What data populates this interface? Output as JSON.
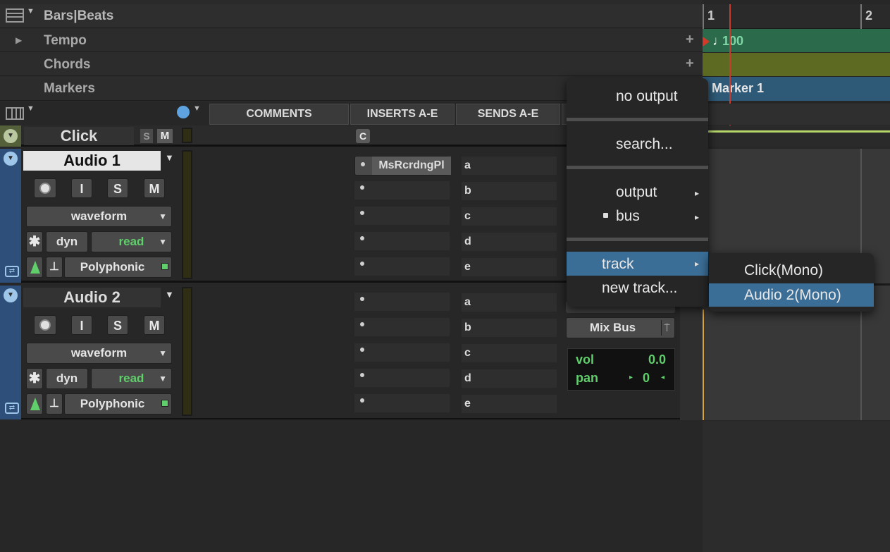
{
  "rulers": {
    "timebase": "Bars|Beats",
    "tempo": "Tempo",
    "chords": "Chords",
    "markers": "Markers",
    "bar_1": "1",
    "bar_2": "2",
    "tempo_value": "100",
    "marker_1": "Marker 1"
  },
  "columns": {
    "comments": "COMMENTS",
    "inserts": "INSERTS A-E",
    "sends": "SENDS A-E"
  },
  "click_track": {
    "name": "Click",
    "solo": "S",
    "mute": "M",
    "insert_badge": "C"
  },
  "tracks": [
    {
      "name": "Audio 1",
      "input": "I",
      "solo": "S",
      "mute": "M",
      "view": "waveform",
      "dyn": "dyn",
      "automation": "read",
      "elastic": "Polyphonic",
      "insert_a": "MsRcrdngPl",
      "sends": [
        "a",
        "b",
        "c",
        "d",
        "e"
      ]
    },
    {
      "name": "Audio 2",
      "input": "I",
      "solo": "S",
      "mute": "M",
      "view": "waveform",
      "dyn": "dyn",
      "automation": "read",
      "elastic": "Polyphonic",
      "sends": [
        "a",
        "b",
        "c",
        "d",
        "e"
      ],
      "io_output": "Mix Bus",
      "vol_label": "vol",
      "vol_value": "0.0",
      "pan_label": "pan",
      "pan_value": "0"
    }
  ],
  "output_menu": {
    "no_output": "no output",
    "search": "search...",
    "output": "output",
    "bus": "bus",
    "track": "track",
    "new_track": "new track..."
  },
  "track_submenu": {
    "items": [
      "Click(Mono)",
      "Audio 2(Mono)"
    ]
  },
  "colors": {
    "tempo_lane": "#2b6b4b",
    "chords_lane": "#5d6b22",
    "marker_lane": "#2e5a78",
    "menu_highlight": "#3b6e97",
    "playhead": "#c83a2e",
    "automation_green": "#5fce6b"
  }
}
